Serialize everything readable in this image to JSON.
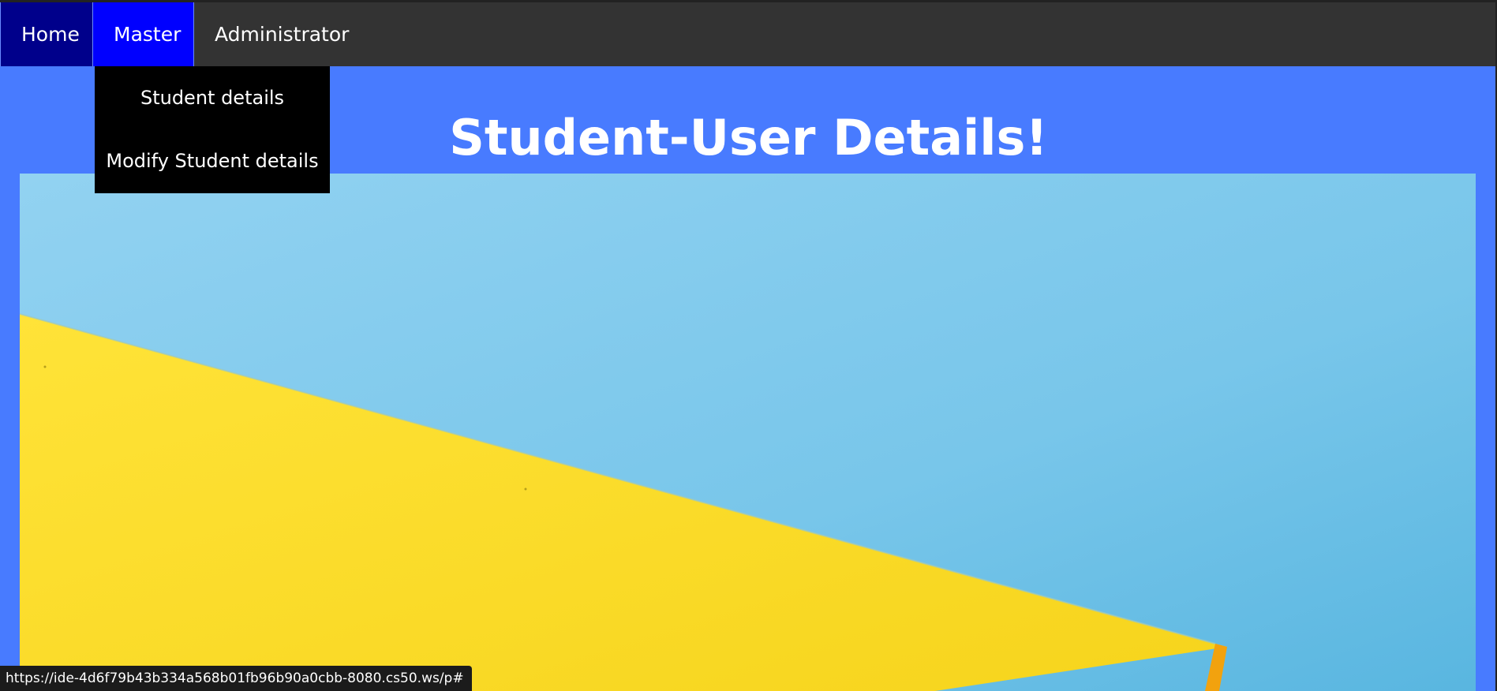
{
  "nav": {
    "items": [
      {
        "label": "Home"
      },
      {
        "label": "Master"
      },
      {
        "label": "Administrator"
      }
    ],
    "active_colors": {
      "home": "#00008b",
      "master": "#0000ff",
      "bar": "#333333"
    }
  },
  "dropdown": {
    "items": [
      {
        "label": "Student details"
      },
      {
        "label": "Modify Student details"
      }
    ]
  },
  "page": {
    "title": "Student-User Details!",
    "background": "#487bff"
  },
  "status": {
    "url": "https://ide-4d6f79b43b334a568b01fb96b90a0cbb-8080.cs50.ws/p#"
  }
}
